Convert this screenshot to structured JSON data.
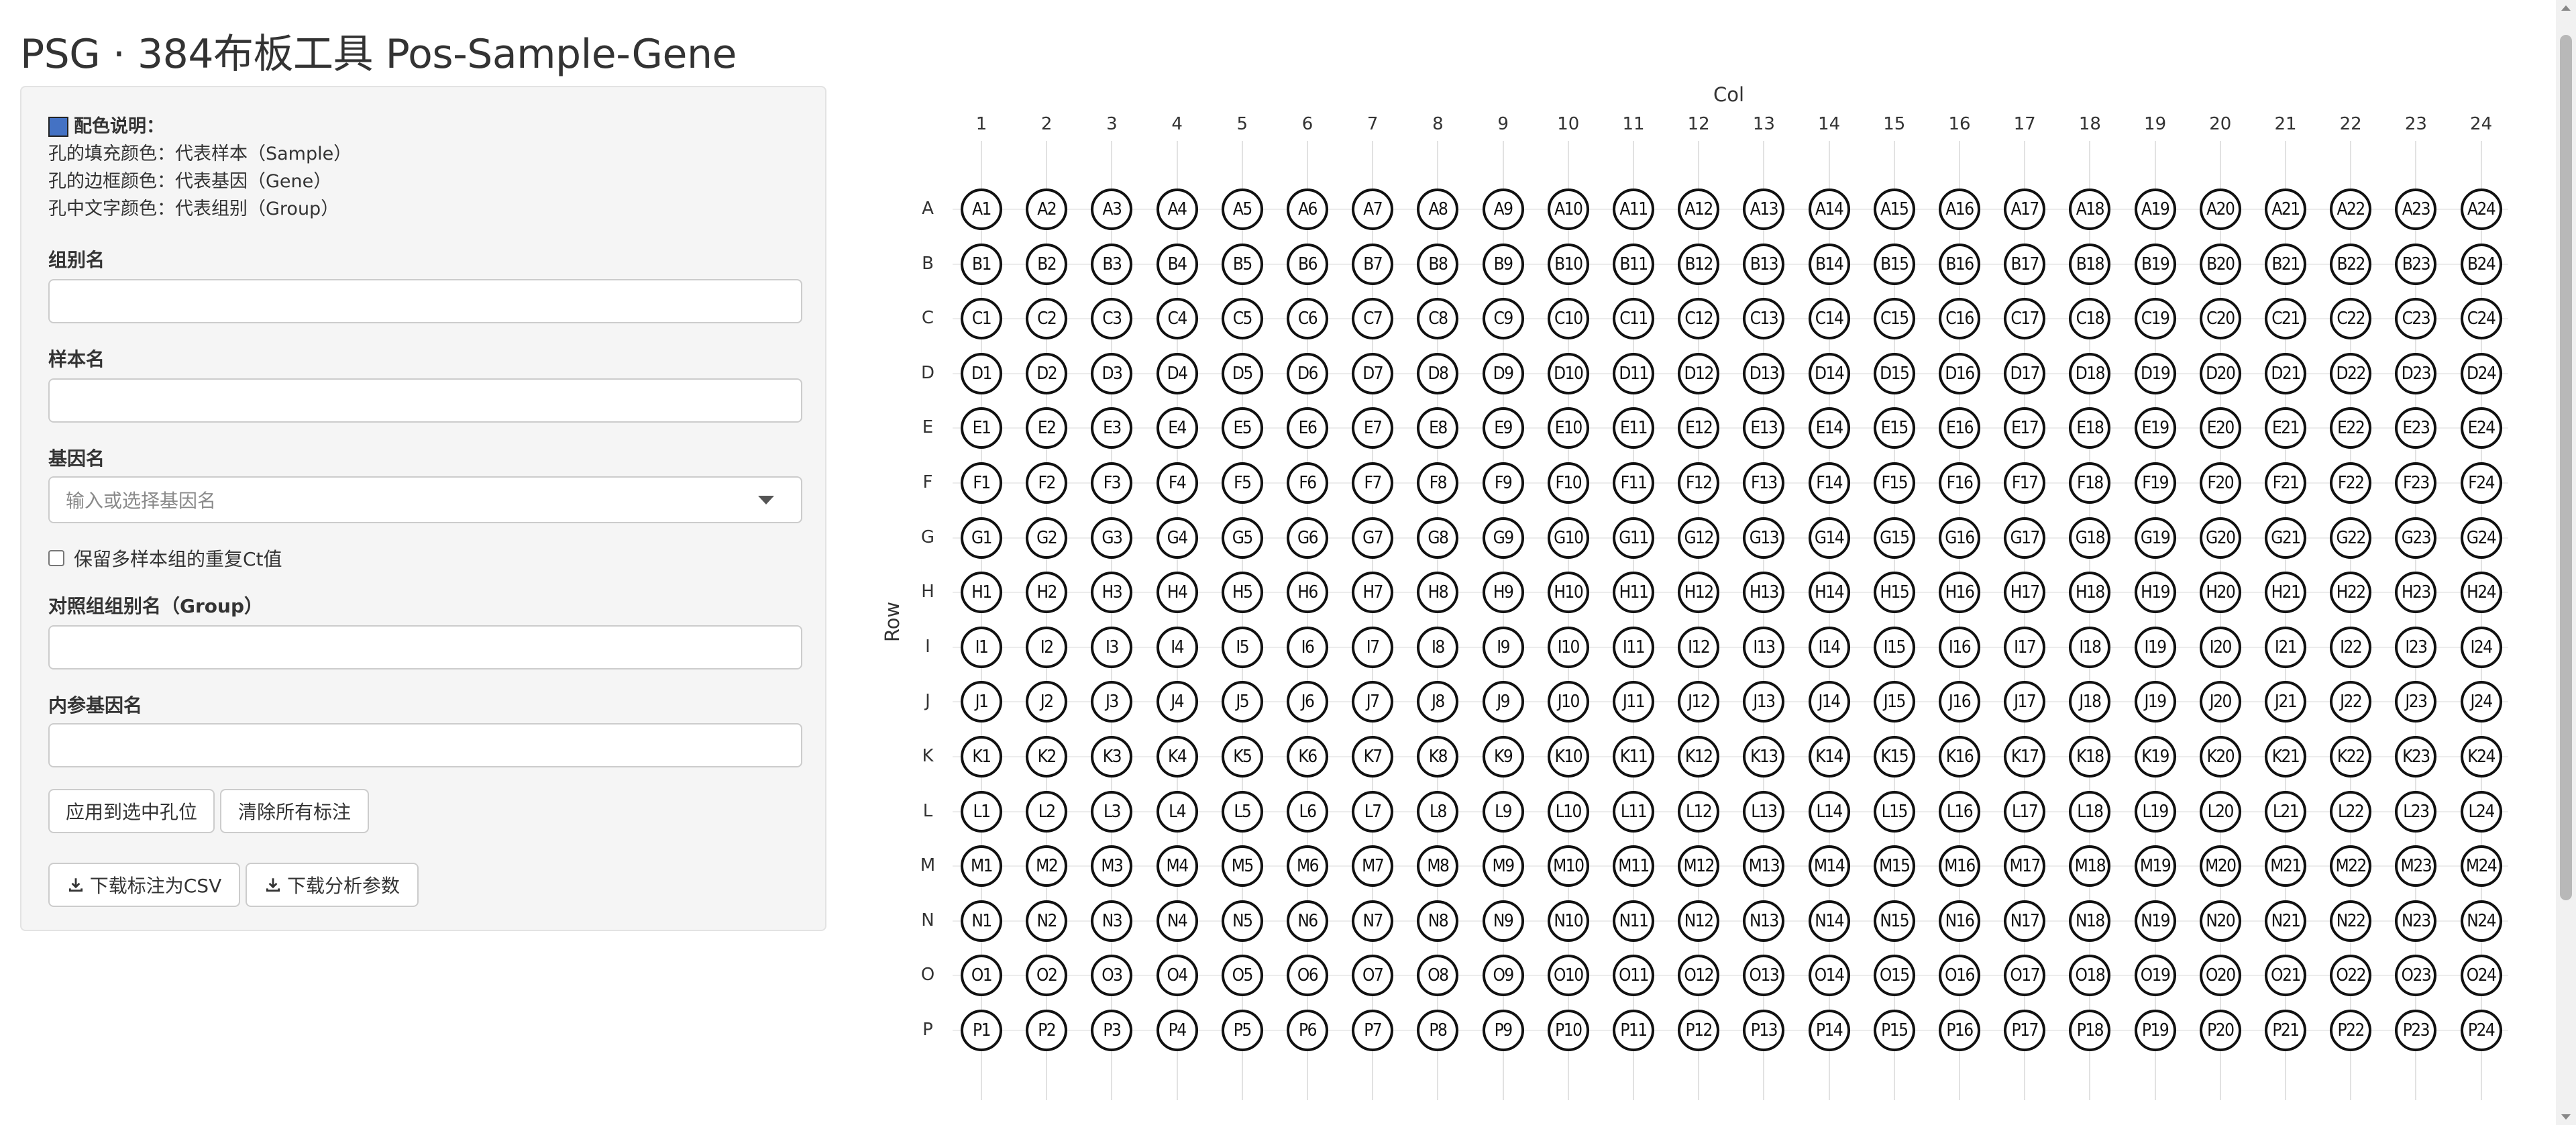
{
  "app": {
    "title": "PSG · 384布板工具 Pos-Sample-Gene"
  },
  "legend": {
    "title": "配色说明：",
    "swatch_color": "#4472c4",
    "lines": [
      "孔的填充颜色：代表样本（Sample）",
      "孔的边框颜色：代表基因（Gene）",
      "孔中文字颜色：代表组别（Group）"
    ]
  },
  "form": {
    "group_label": "组别名",
    "group_value": "",
    "sample_label": "样本名",
    "sample_value": "",
    "gene_label": "基因名",
    "gene_placeholder": "输入或选择基因名",
    "keep_replicates_label": "保留多样本组的重复Ct值",
    "keep_replicates_checked": false,
    "control_group_label": "对照组组别名（Group）",
    "control_group_value": "",
    "ref_gene_label": "内参基因名",
    "ref_gene_value": ""
  },
  "buttons": {
    "apply": "应用到选中孔位",
    "clear": "清除所有标注",
    "download_csv": "下载标注为CSV",
    "download_params": "下载分析参数"
  },
  "plate": {
    "col_axis_title": "Col",
    "row_axis_title": "Row",
    "rows": [
      "A",
      "B",
      "C",
      "D",
      "E",
      "F",
      "G",
      "H",
      "I",
      "J",
      "K",
      "L",
      "M",
      "N",
      "O",
      "P"
    ],
    "cols": [
      "1",
      "2",
      "3",
      "4",
      "5",
      "6",
      "7",
      "8",
      "9",
      "10",
      "11",
      "12",
      "13",
      "14",
      "15",
      "16",
      "17",
      "18",
      "19",
      "20",
      "21",
      "22",
      "23",
      "24"
    ],
    "well_border_color": "#111111",
    "well_fill_color": "#ffffff"
  }
}
